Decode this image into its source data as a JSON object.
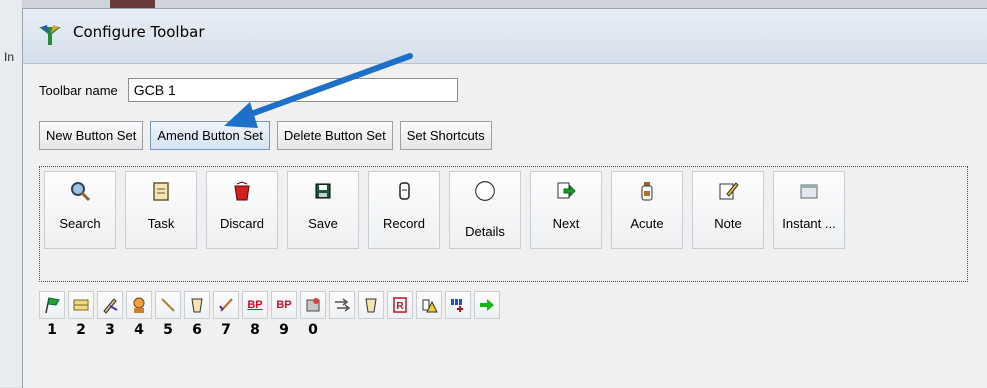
{
  "window": {
    "title": "Configure Toolbar",
    "background_fragment": "In"
  },
  "toolbar_name": {
    "label": "Toolbar name",
    "value": "GCB 1"
  },
  "set_buttons": [
    {
      "label": "New Button Set"
    },
    {
      "label": "Amend Button Set"
    },
    {
      "label": "Delete Button Set"
    },
    {
      "label": "Set Shortcuts"
    }
  ],
  "main_toolbar": [
    {
      "label": "Search",
      "icon": "search-icon"
    },
    {
      "label": "Task",
      "icon": "task-icon"
    },
    {
      "label": "Discard",
      "icon": "discard-icon"
    },
    {
      "label": "Save",
      "icon": "save-icon"
    },
    {
      "label": "Record",
      "icon": "record-icon"
    },
    {
      "label": "Details",
      "icon": "circle-icon"
    },
    {
      "label": "Next",
      "icon": "next-icon"
    },
    {
      "label": "Acute",
      "icon": "acute-icon"
    },
    {
      "label": "Note",
      "icon": "note-icon"
    },
    {
      "label": "Instant ...",
      "icon": "instant-icon"
    }
  ],
  "shortcut_toolbar": {
    "icons": [
      "flag-icon",
      "grid-icon",
      "pen-icon",
      "person-icon",
      "line-icon",
      "cup-icon",
      "check-icon",
      "bp-graph-icon",
      "bp-icon",
      "stamp-icon",
      "arrows-icon",
      "cup-icon",
      "document-r-icon",
      "warning-icon",
      "chart-icon",
      "right-arrow-icon"
    ],
    "bp_label": "BP",
    "numbers": [
      "1",
      "2",
      "3",
      "4",
      "5",
      "6",
      "7",
      "8",
      "9",
      "0"
    ]
  },
  "colors": {
    "annotation_arrow": "#1e6fc8",
    "bp_red": "#c8102e",
    "next_green": "#14b814"
  }
}
